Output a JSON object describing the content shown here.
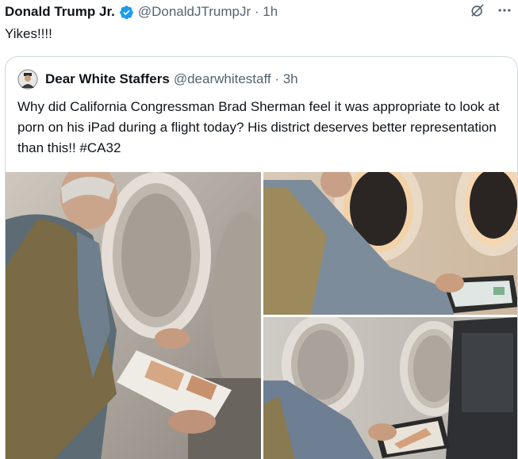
{
  "post": {
    "author_name": "Donald Trump Jr.",
    "handle_time": "@DonaldJTrumpJr · 1h",
    "text": "Yikes!!!!"
  },
  "quote": {
    "author_name": "Dear White Staffers",
    "handle_time": "@dearwhitestaff · 3h",
    "text": "Why did California Congressman Brad Sherman feel it was appropriate to look at porn on his iPad during a flight today? His district deserves better representation than this!! #CA32"
  },
  "icons": {
    "verified": "verified-badge-icon",
    "grok": "grok-icon",
    "more": "more-options-icon"
  },
  "colors": {
    "verified_blue": "#1d9bf0",
    "secondary_text": "#536471",
    "border": "#cfd9de"
  },
  "media": {
    "count": 3,
    "photos": [
      "photo-1",
      "photo-2",
      "photo-3"
    ]
  }
}
